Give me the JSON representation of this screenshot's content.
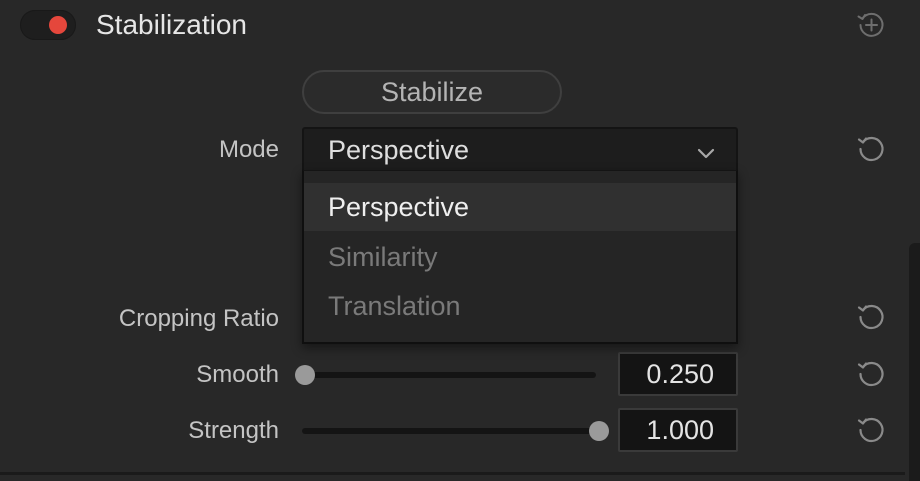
{
  "header": {
    "title": "Stabilization",
    "enabled": true,
    "toggle_color": "#e5473c",
    "add_icon": "add-keyframe-icon"
  },
  "stabilize_button": {
    "label": "Stabilize"
  },
  "mode": {
    "label": "Mode",
    "value": "Perspective",
    "options": [
      "Perspective",
      "Similarity",
      "Translation"
    ],
    "highlighted_option": "Perspective"
  },
  "cropping_ratio": {
    "label": "Cropping Ratio"
  },
  "smooth": {
    "label": "Smooth",
    "value": "0.250",
    "slider_fraction": 0.0
  },
  "strength": {
    "label": "Strength",
    "value": "1.000",
    "slider_fraction": 1.0
  },
  "icons": {
    "reset": "reset-icon",
    "dropdown": "chevron-down-icon"
  }
}
